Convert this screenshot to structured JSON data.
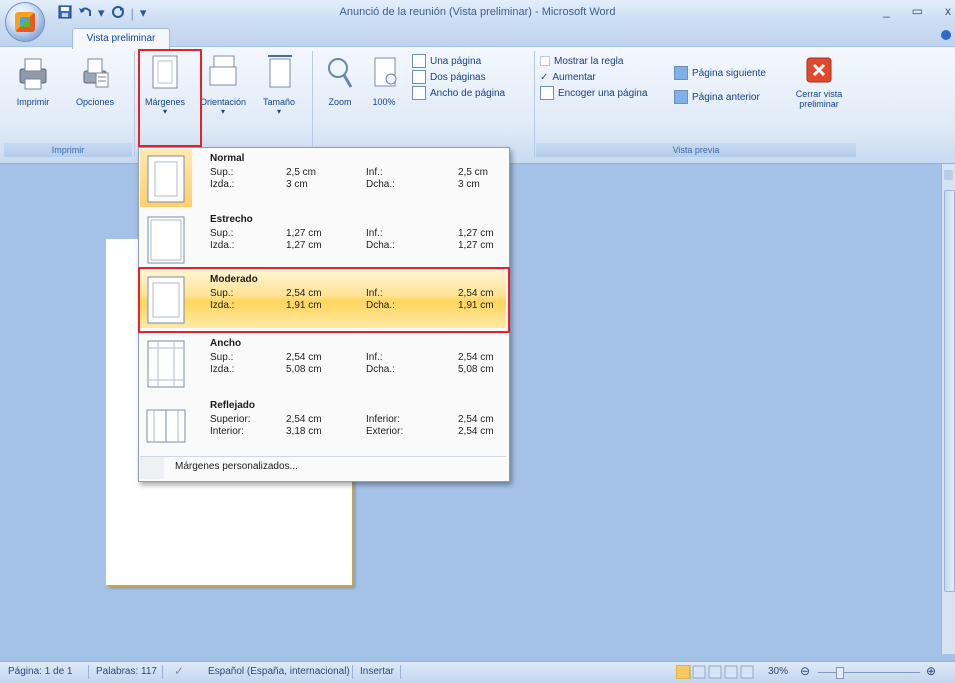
{
  "window": {
    "title": "Anunció de la reunión (Vista preliminar) - Microsoft Word",
    "controls": [
      "_",
      "▭",
      "x"
    ]
  },
  "quick_access": {
    "save_icon": "save-icon",
    "undo_icon": "undo-icon",
    "redo_icon": "redo-icon",
    "separator": "|",
    "more": "▾"
  },
  "tabs": [
    {
      "label": "Vista preliminar",
      "active": true
    }
  ],
  "ribbon": {
    "print_group": {
      "label": "Imprimir",
      "buttons": [
        {
          "label": "Imprimir",
          "icon": "printer-icon"
        },
        {
          "label": "Opciones",
          "icon": "print-options-icon"
        }
      ]
    },
    "page_setup_group": {
      "buttons": [
        {
          "label": "Márgenes",
          "icon": "margins-icon",
          "arrow": "▾",
          "highlighted": true
        },
        {
          "label": "Orientación",
          "icon": "orientation-icon",
          "arrow": "▾"
        },
        {
          "label": "Tamaño",
          "icon": "size-icon",
          "arrow": "▾"
        }
      ]
    },
    "zoom_group": {
      "buttons": [
        {
          "label": "Zoom",
          "icon": "magnifier-icon"
        },
        {
          "label": "100%",
          "icon": "page-100-icon"
        }
      ],
      "small_buttons": [
        "Una página",
        "Dos páginas",
        "Ancho de página"
      ]
    },
    "preview_group": {
      "label": "Vista previa",
      "checkboxes": [
        {
          "label": "Mostrar la regla",
          "checked": false
        },
        {
          "label": "Aumentar",
          "checked": true
        }
      ],
      "small_buttons": [
        "Encoger una página"
      ],
      "nav_buttons": [
        "Página siguiente",
        "Página anterior"
      ],
      "close": {
        "label_line1": "Cerrar vista",
        "label_line2": "preliminar",
        "icon": "close-preview-icon"
      }
    }
  },
  "margins_menu": {
    "options": [
      {
        "name": "Normal",
        "k1": "Sup.:",
        "v1": "2,5 cm",
        "k2": "Izda.:",
        "v2": "3 cm",
        "rk1": "Inf.:",
        "rv1": "2,5 cm",
        "rk2": "Dcha.:",
        "rv2": "3 cm"
      },
      {
        "name": "Estrecho",
        "k1": "Sup.:",
        "v1": "1,27 cm",
        "k2": "Izda.:",
        "v2": "1,27 cm",
        "rk1": "Inf.:",
        "rv1": "1,27 cm",
        "rk2": "Dcha.:",
        "rv2": "1,27 cm"
      },
      {
        "name": "Moderado",
        "k1": "Sup.:",
        "v1": "2,54 cm",
        "k2": "Izda.:",
        "v2": "1,91 cm",
        "rk1": "Inf.:",
        "rv1": "2,54 cm",
        "rk2": "Dcha.:",
        "rv2": "1,91 cm"
      },
      {
        "name": "Ancho",
        "k1": "Sup.:",
        "v1": "2,54 cm",
        "k2": "Izda.:",
        "v2": "5,08 cm",
        "rk1": "Inf.:",
        "rv1": "2,54 cm",
        "rk2": "Dcha.:",
        "rv2": "5,08 cm"
      },
      {
        "name": "Reflejado",
        "k1": "Superior:",
        "v1": "2,54 cm",
        "k2": "Interior:",
        "v2": "3,18 cm",
        "rk1": "Inferior:",
        "rv1": "2,54 cm",
        "rk2": "Exterior:",
        "rv2": "2,54 cm"
      }
    ],
    "selected": "Normal",
    "hovered": "Moderado",
    "custom": "Márgenes personalizados..."
  },
  "status": {
    "page": "Página: 1 de 1",
    "words": "Palabras: 117",
    "language": "Español (España, internacional)",
    "mode": "Insertar",
    "zoom": "30%",
    "zoom_minus": "⊖",
    "zoom_plus": "⊕"
  },
  "colors": {
    "highlight_border": "#e5212b",
    "hover": "#ffd55c",
    "workspace": "#a4c2e8"
  }
}
